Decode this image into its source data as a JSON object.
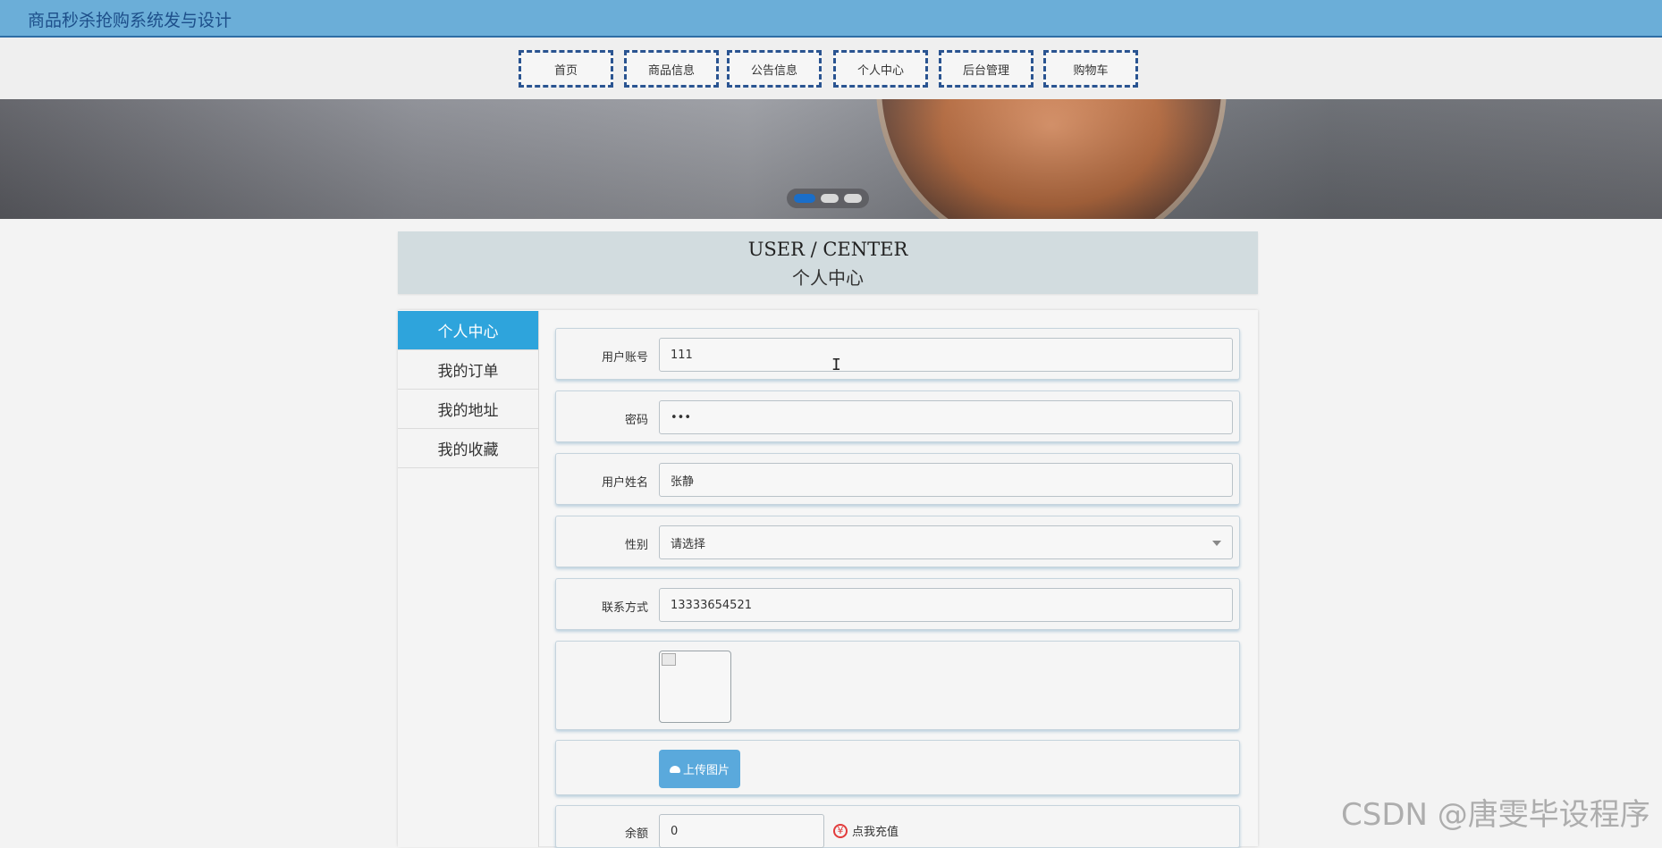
{
  "app": {
    "title": "商品秒杀抢购系统发与设计"
  },
  "nav": {
    "items": [
      {
        "label": "首页"
      },
      {
        "label": "商品信息"
      },
      {
        "label": "公告信息"
      },
      {
        "label": "个人中心"
      },
      {
        "label": "后台管理"
      },
      {
        "label": "购物车"
      }
    ]
  },
  "banner": {
    "active_slide": 1,
    "slide_count": 3
  },
  "heading": {
    "en": "USER / CENTER",
    "zh": "个人中心"
  },
  "sidebar": {
    "items": [
      {
        "label": "个人中心",
        "active": true
      },
      {
        "label": "我的订单"
      },
      {
        "label": "我的地址"
      },
      {
        "label": "我的收藏"
      }
    ]
  },
  "form": {
    "account_label": "用户账号",
    "account_value": "111",
    "password_label": "密码",
    "password_value": "•••",
    "name_label": "用户姓名",
    "name_value": "张静",
    "gender_label": "性别",
    "gender_value": "请选择",
    "phone_label": "联系方式",
    "phone_value": "13333654521",
    "upload_label": "上传图片",
    "balance_label": "余额",
    "balance_value": "0",
    "recharge_label": "点我充值",
    "recharge_icon": "¥"
  },
  "watermark": "CSDN @唐雯毕设程序",
  "colors": {
    "topbar": "#6baed8",
    "accent": "#2ea4dc",
    "nav_border": "#2a5491",
    "recharge": "#e23b3b"
  }
}
